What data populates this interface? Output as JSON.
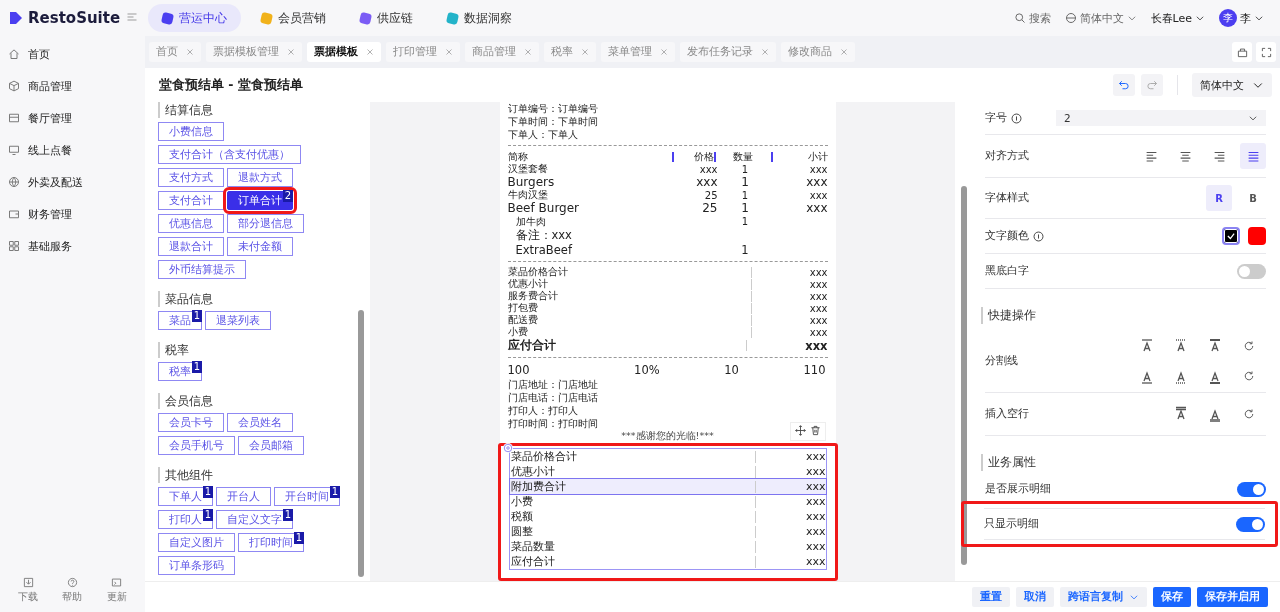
{
  "brand": {
    "name": "RestoSuite"
  },
  "top_nav": [
    {
      "label": "营运中心",
      "selected": true
    },
    {
      "label": "会员营销",
      "selected": false
    },
    {
      "label": "供应链",
      "selected": false
    },
    {
      "label": "数据洞察",
      "selected": false
    }
  ],
  "header": {
    "search": "搜索",
    "language": "简体中文",
    "store": "长春Lee",
    "avatar": "李",
    "user": "李"
  },
  "sidebar": {
    "items": [
      {
        "label": "首页"
      },
      {
        "label": "商品管理"
      },
      {
        "label": "餐厅管理"
      },
      {
        "label": "线上点餐"
      },
      {
        "label": "外卖及配送"
      },
      {
        "label": "财务管理"
      },
      {
        "label": "基础服务"
      }
    ],
    "footer": [
      {
        "label": "下载"
      },
      {
        "label": "帮助"
      },
      {
        "label": "更新"
      }
    ]
  },
  "tabs": [
    {
      "label": "首页",
      "selected": false
    },
    {
      "label": "票据模板管理",
      "selected": false
    },
    {
      "label": "票据模板",
      "selected": true
    },
    {
      "label": "打印管理",
      "selected": false
    },
    {
      "label": "商品管理",
      "selected": false
    },
    {
      "label": "税率",
      "selected": false
    },
    {
      "label": "菜单管理",
      "selected": false
    },
    {
      "label": "发布任务记录",
      "selected": false
    },
    {
      "label": "修改商品",
      "selected": false
    }
  ],
  "page": {
    "title": "堂食预结单 - 堂食预结单",
    "language": "简体中文"
  },
  "components": [
    {
      "title": "结算信息",
      "items": [
        {
          "label": "小费信息",
          "selected": false
        },
        {
          "label": "支付合计（含支付优惠）",
          "selected": false
        },
        {
          "label": "支付方式",
          "selected": false
        },
        {
          "label": "退款方式",
          "selected": false
        },
        {
          "label": "支付合计",
          "selected": false
        },
        {
          "label": "订单合计",
          "selected": true,
          "badge": "2",
          "highlighted": true
        },
        {
          "label": "优惠信息",
          "selected": false
        },
        {
          "label": "部分退信息",
          "selected": false
        },
        {
          "label": "退款合计",
          "selected": false
        },
        {
          "label": "未付金额",
          "selected": false
        },
        {
          "label": "外币结算提示",
          "selected": false
        }
      ]
    },
    {
      "title": "菜品信息",
      "items": [
        {
          "label": "菜品",
          "selected": false,
          "badge": "1"
        },
        {
          "label": "退菜列表",
          "selected": false
        }
      ]
    },
    {
      "title": "税率",
      "items": [
        {
          "label": "税率",
          "selected": false,
          "badge": "1"
        }
      ]
    },
    {
      "title": "会员信息",
      "items": [
        {
          "label": "会员卡号",
          "selected": false
        },
        {
          "label": "会员姓名",
          "selected": false
        },
        {
          "label": "会员手机号",
          "selected": false
        },
        {
          "label": "会员邮箱",
          "selected": false
        }
      ]
    },
    {
      "title": "其他组件",
      "items": [
        {
          "label": "下单人",
          "selected": false,
          "badge": "1"
        },
        {
          "label": "开台人",
          "selected": false
        },
        {
          "label": "开台时间",
          "selected": false,
          "badge": "1"
        },
        {
          "label": "打印人",
          "selected": false,
          "badge": "1"
        },
        {
          "label": "自定义文字",
          "selected": false,
          "badge": "1"
        },
        {
          "label": "自定义图片",
          "selected": false
        },
        {
          "label": "打印时间",
          "selected": false,
          "badge": "1"
        },
        {
          "label": "订单条形码",
          "selected": false
        }
      ]
    }
  ],
  "receipt": {
    "header_lines": [
      "订单编号：订单编号",
      "下单时间：下单时间",
      "下单人：下单人"
    ],
    "item_columns": [
      "简称",
      "价格",
      "数量",
      "小计"
    ],
    "items": [
      {
        "kind": "small",
        "name": "汉堡套餐",
        "price": "xxx",
        "qty": "1",
        "subtotal": "xxx"
      },
      {
        "kind": "large",
        "name": "Burgers",
        "price": "xxx",
        "qty": "1",
        "subtotal": "xxx"
      },
      {
        "kind": "small",
        "name": "牛肉汉堡",
        "price": "25",
        "qty": "1",
        "subtotal": "xxx"
      },
      {
        "kind": "large",
        "name": "Beef Burger",
        "price": "25",
        "qty": "1",
        "subtotal": "xxx"
      },
      {
        "kind": "modifier",
        "name": "加牛肉",
        "qty": "1"
      },
      {
        "kind": "note",
        "name": "备注：xxx"
      },
      {
        "kind": "modifier-large",
        "name": "ExtraBeef",
        "qty": "1"
      }
    ],
    "totals": [
      {
        "label": "菜品价格合计",
        "value": "xxx",
        "bold": false
      },
      {
        "label": "优惠小计",
        "value": "xxx",
        "bold": false
      },
      {
        "label": "服务费合计",
        "value": "xxx",
        "bold": false
      },
      {
        "label": "打包费",
        "value": "xxx",
        "bold": false
      },
      {
        "label": "配送费",
        "value": "xxx",
        "bold": false
      },
      {
        "label": "小费",
        "value": "xxx",
        "bold": false
      },
      {
        "label": "应付合计",
        "value": "xxx",
        "bold": true
      }
    ],
    "summary": [
      "100",
      "10%",
      "10",
      "110"
    ],
    "footer_lines": [
      "门店地址：门店地址",
      "门店电话：门店电话",
      "打印人：打印人",
      "打印时间：打印时间"
    ],
    "thanks": "***感谢您的光临!***",
    "selected_block": {
      "highlighted": true,
      "rows": [
        {
          "label": "菜品价格合计",
          "value": "xxx",
          "selected": false
        },
        {
          "label": "优惠小计",
          "value": "xxx",
          "selected": false
        },
        {
          "label": "附加费合计",
          "value": "xxx",
          "selected": true
        },
        {
          "label": "小费",
          "value": "xxx",
          "selected": false
        },
        {
          "label": "税额",
          "value": "xxx",
          "selected": false
        },
        {
          "label": "圆整",
          "value": "xxx",
          "selected": false
        },
        {
          "label": "菜品数量",
          "value": "xxx",
          "selected": false
        },
        {
          "label": "应付合计",
          "value": "xxx",
          "selected": false
        }
      ]
    }
  },
  "properties": [
    {
      "kind": "select",
      "label": "字号",
      "info": true,
      "value": "2"
    },
    {
      "kind": "align",
      "label": "对齐方式",
      "options": [
        {
          "selected": false
        },
        {
          "selected": false
        },
        {
          "selected": false
        },
        {
          "selected": true
        }
      ]
    },
    {
      "kind": "style",
      "label": "字体样式",
      "options": [
        {
          "label": "R",
          "selected": true
        },
        {
          "label": "B",
          "selected": false
        }
      ]
    },
    {
      "kind": "color",
      "label": "文字颜色",
      "info": true,
      "colors": [
        {
          "color": "#000000",
          "selected": true
        },
        {
          "color": "#ff0000",
          "selected": false
        }
      ]
    },
    {
      "kind": "toggle",
      "label": "黑底白字",
      "on": false
    }
  ],
  "quick_actions": {
    "title": "快捷操作",
    "rows": [
      {
        "label": "分割线"
      },
      {
        "label": "插入空行"
      }
    ]
  },
  "business": {
    "title": "业务属性",
    "rows": [
      {
        "label": "是否展示明细",
        "on": true,
        "highlighted": false
      },
      {
        "label": "只显示明细",
        "on": true,
        "highlighted": true
      }
    ]
  },
  "actions": [
    {
      "label": "重置",
      "kind": "secondary"
    },
    {
      "label": "取消",
      "kind": "secondary"
    },
    {
      "label": "跨语言复制",
      "kind": "dropdown"
    },
    {
      "label": "保存",
      "kind": "primary"
    },
    {
      "label": "保存并启用",
      "kind": "primary"
    }
  ]
}
